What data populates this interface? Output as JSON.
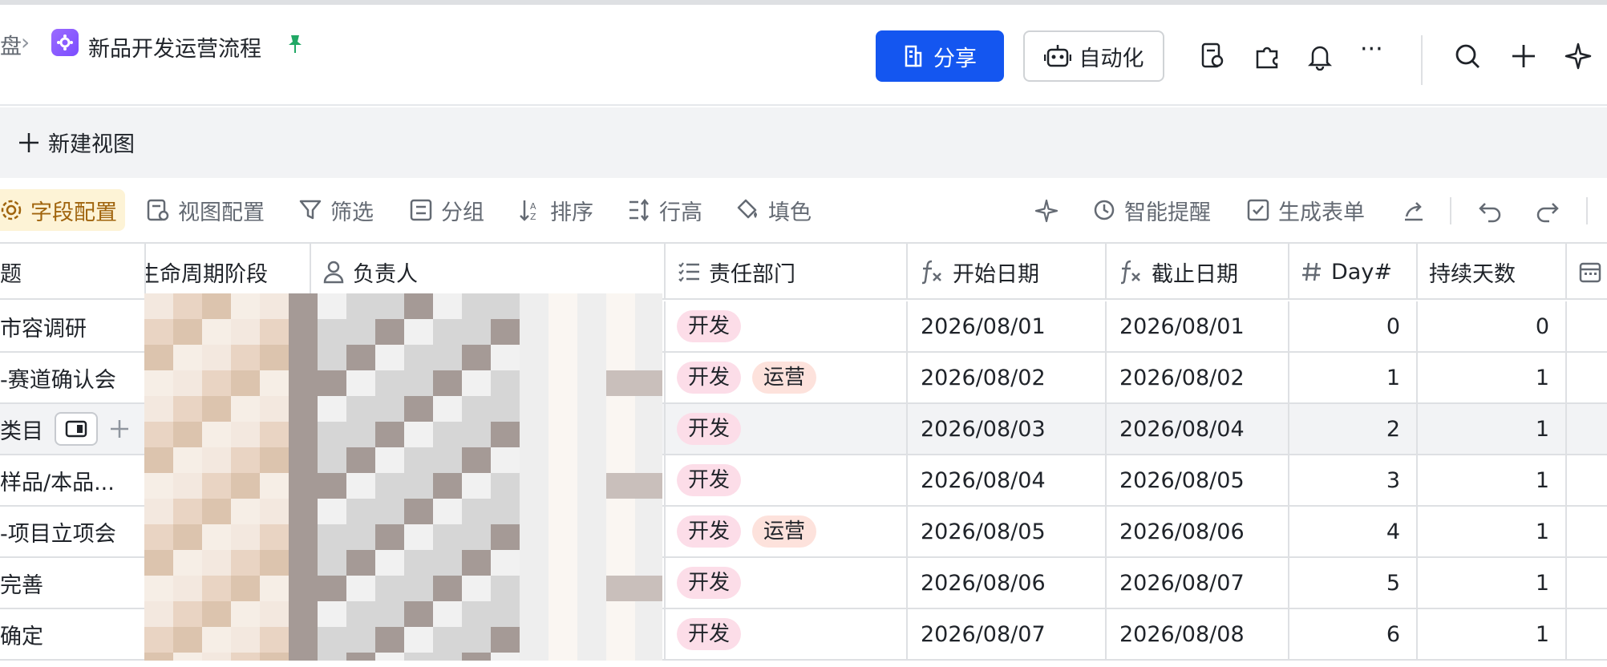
{
  "header": {
    "breadcrumb_prev": "盘",
    "breadcrumb_sep": "›",
    "doc_title": "新品开发运营流程",
    "share_label": "分享",
    "automation_label": "自动化",
    "more_label": "···"
  },
  "viewbar": {
    "new_view_label": "新建视图"
  },
  "toolbar": {
    "field_config": "字段配置",
    "view_config": "视图配置",
    "filter": "筛选",
    "group": "分组",
    "sort": "排序",
    "row_height": "行高",
    "fill_color": "填色",
    "smart_reminder": "智能提醒",
    "generate_form": "生成表单"
  },
  "table": {
    "columns": {
      "title": "题",
      "lifecycle": "生命周期阶段",
      "owner": "负责人",
      "department": "责任部门",
      "start_date": "开始日期",
      "end_date": "截止日期",
      "day": "Day#",
      "duration": "持续天数"
    },
    "rows": [
      {
        "title": "市容调研",
        "depts": [
          "开发"
        ],
        "start": "2026/08/01",
        "end": "2026/08/01",
        "day": "0",
        "duration": "0"
      },
      {
        "title": "-赛道确认会",
        "depts": [
          "开发",
          "运营"
        ],
        "start": "2026/08/02",
        "end": "2026/08/02",
        "day": "1",
        "duration": "1"
      },
      {
        "title": "类目",
        "depts": [
          "开发"
        ],
        "start": "2026/08/03",
        "end": "2026/08/04",
        "day": "2",
        "duration": "1"
      },
      {
        "title": "样品/本品...",
        "depts": [
          "开发"
        ],
        "start": "2026/08/04",
        "end": "2026/08/05",
        "day": "3",
        "duration": "1"
      },
      {
        "title": "-项目立项会",
        "depts": [
          "开发",
          "运营"
        ],
        "start": "2026/08/05",
        "end": "2026/08/06",
        "day": "4",
        "duration": "1"
      },
      {
        "title": "完善",
        "depts": [
          "开发"
        ],
        "start": "2026/08/06",
        "end": "2026/08/07",
        "day": "5",
        "duration": "1"
      },
      {
        "title": "确定",
        "depts": [
          "开发"
        ],
        "start": "2026/08/07",
        "end": "2026/08/08",
        "day": "6",
        "duration": "1"
      }
    ]
  },
  "colors": {
    "accent": "#1456f0",
    "dev_tag": "#fcdde8",
    "ops_tag": "#fde2dc",
    "active_tool": "#fdf3d6"
  }
}
